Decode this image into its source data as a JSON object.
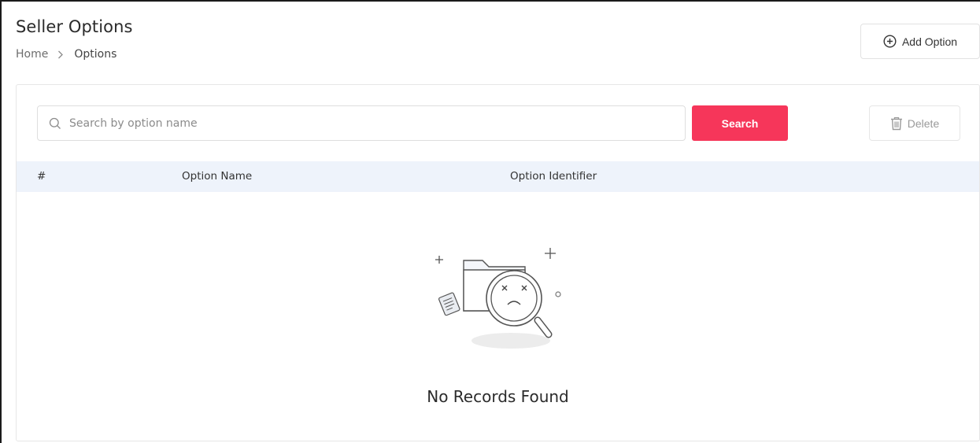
{
  "header": {
    "title": "Seller Options",
    "breadcrumb": {
      "home": "Home",
      "current": "Options"
    },
    "add_button_label": "Add Option"
  },
  "toolbar": {
    "search_placeholder": "Search by option name",
    "search_value": "",
    "search_button_label": "Search",
    "delete_button_label": "Delete"
  },
  "table": {
    "columns": [
      "#",
      "Option Name",
      "Option Identifier"
    ],
    "rows": []
  },
  "empty_state": {
    "message": "No Records Found"
  },
  "colors": {
    "accent": "#f6365a",
    "table_header_bg": "#eef3fb",
    "border": "#e2e2e2"
  },
  "icons": {
    "add": "plus-circle-icon",
    "search": "magnifier-icon",
    "delete": "trash-icon",
    "empty": "no-records-illustration"
  }
}
